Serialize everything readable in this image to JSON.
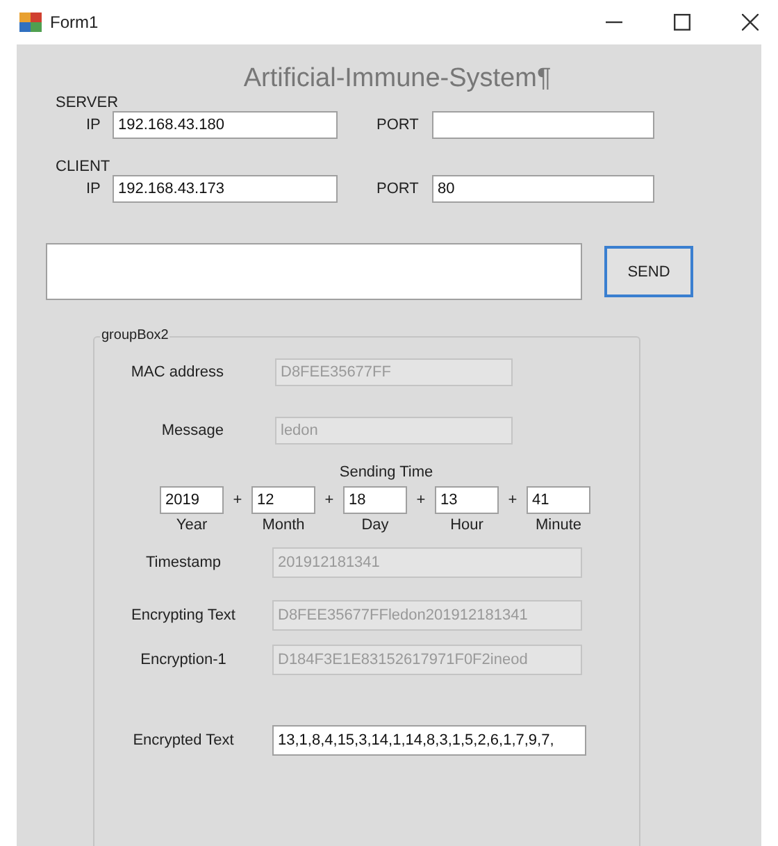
{
  "window": {
    "title": "Form1"
  },
  "heading": "Artificial-Immune-System¶",
  "endpoints": [
    {
      "label": "SERVER",
      "ip_label": "IP",
      "ip": "192.168.43.180",
      "port_label": "PORT"
    },
    {
      "label": "CLIENT",
      "ip_label": "IP",
      "ip": "192.168.43.173",
      "port_label": "PORT",
      "port": "80"
    }
  ],
  "send_button": "SEND",
  "group": {
    "title": "groupBox2",
    "top_fields": [
      {
        "label": "MAC address",
        "value": "D8FEE35677FF",
        "disabled": true
      },
      {
        "label": "Message",
        "value": "ledon",
        "disabled": true
      }
    ],
    "time": {
      "label": "Sending Time",
      "parts": [
        {
          "value": "2019",
          "label": "Year"
        },
        {
          "separator": "+",
          "value": "12",
          "label": "Month"
        },
        {
          "separator": "+",
          "value": "18",
          "label": "Day"
        },
        {
          "separator": "+",
          "value": "13",
          "label": "Hour"
        },
        {
          "separator": "+",
          "value": "41",
          "label": "Minute"
        }
      ]
    },
    "bottom_fields": [
      {
        "label": "Timestamp",
        "value": "201912181341",
        "disabled": true
      },
      {
        "label": "Encrypting Text",
        "value": "D8FEE35677FFledon201912181341",
        "disabled": true
      },
      {
        "label": "Encryption-1",
        "value": "D184F3E1E83152617971F0F2ineod",
        "disabled": true
      },
      {
        "label": "Encrypted Text",
        "value": "13,1,8,4,15,3,14,1,14,8,3,1,5,2,6,1,7,9,7,",
        "disabled": false
      }
    ]
  }
}
